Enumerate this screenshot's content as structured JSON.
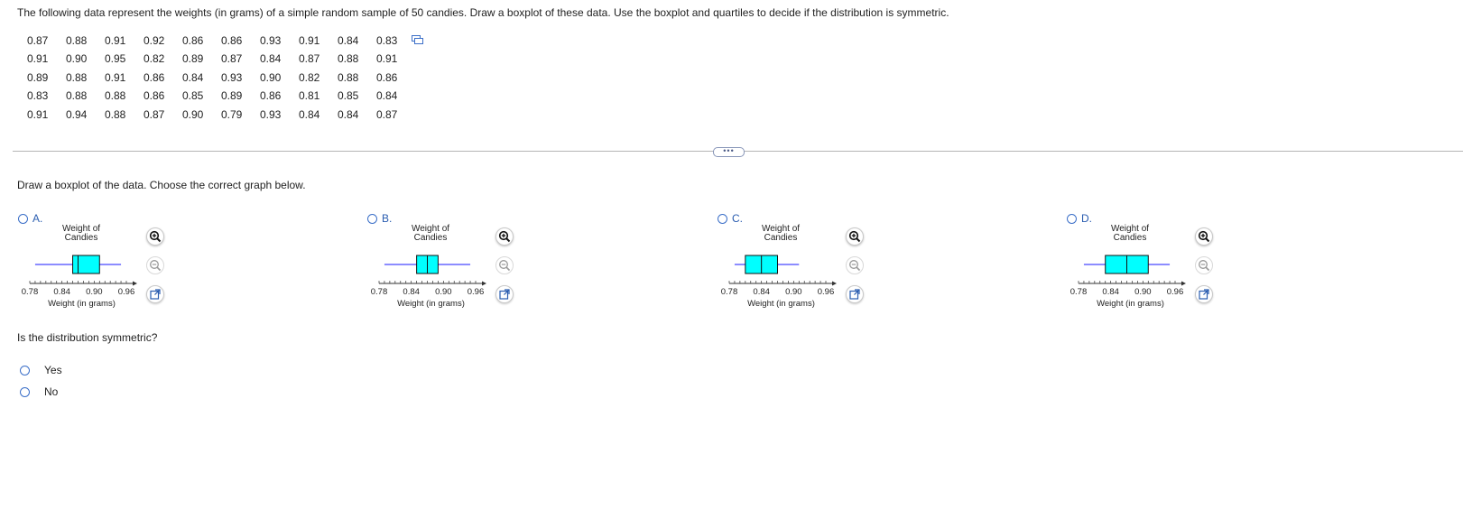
{
  "question": "The following data represent the weights (in grams) of a simple random sample of 50 candies. Draw a boxplot of these data. Use the boxplot and quartiles to decide if the distribution is symmetric.",
  "data_rows": [
    [
      "0.87",
      "0.88",
      "0.91",
      "0.92",
      "0.86",
      "0.86",
      "0.93",
      "0.91",
      "0.84",
      "0.83"
    ],
    [
      "0.91",
      "0.90",
      "0.95",
      "0.82",
      "0.89",
      "0.87",
      "0.84",
      "0.87",
      "0.88",
      "0.91"
    ],
    [
      "0.89",
      "0.88",
      "0.91",
      "0.86",
      "0.84",
      "0.93",
      "0.90",
      "0.82",
      "0.88",
      "0.86"
    ],
    [
      "0.83",
      "0.88",
      "0.88",
      "0.86",
      "0.85",
      "0.89",
      "0.86",
      "0.81",
      "0.85",
      "0.84"
    ],
    [
      "0.91",
      "0.94",
      "0.88",
      "0.87",
      "0.90",
      "0.79",
      "0.93",
      "0.84",
      "0.84",
      "0.87"
    ]
  ],
  "more_button": "•••",
  "instruction": "Draw a boxplot of the data. Choose the correct graph below.",
  "colors": {
    "box_fill": "#00ffff",
    "whisker": "#1a1aff",
    "radio": "#3b6fc8",
    "letter": "#2a5db0"
  },
  "options": [
    {
      "letter": "A.",
      "title_line1": "Weight of",
      "title_line2": "Candies",
      "box": {
        "min": 0.79,
        "q1": 0.86,
        "median": 0.87,
        "q3": 0.91,
        "max": 0.95
      }
    },
    {
      "letter": "B.",
      "title_line1": "Weight of",
      "title_line2": "Candies",
      "box": {
        "min": 0.79,
        "q1": 0.85,
        "median": 0.87,
        "q3": 0.89,
        "max": 0.95
      }
    },
    {
      "letter": "C.",
      "title_line1": "Weight of",
      "title_line2": "Candies",
      "box": {
        "min": 0.79,
        "q1": 0.81,
        "median": 0.84,
        "q3": 0.87,
        "max": 0.91
      }
    },
    {
      "letter": "D.",
      "title_line1": "Weight of",
      "title_line2": "Candies",
      "box": {
        "min": 0.79,
        "q1": 0.83,
        "median": 0.87,
        "q3": 0.91,
        "max": 0.95
      }
    }
  ],
  "axis": {
    "ticks": [
      "0.78",
      "0.84",
      "0.90",
      "0.96"
    ],
    "xlabel": "Weight (in grams)",
    "min": 0.78,
    "max": 0.96,
    "minor_step": 0.01
  },
  "icons": {
    "zoom_in": "zoom-in-icon",
    "zoom_out": "zoom-out-icon",
    "popout": "open-in-new-window-icon",
    "copy": "copy-data-icon"
  },
  "symmetric_question": "Is the distribution symmetric?",
  "answers": [
    "Yes",
    "No"
  ]
}
